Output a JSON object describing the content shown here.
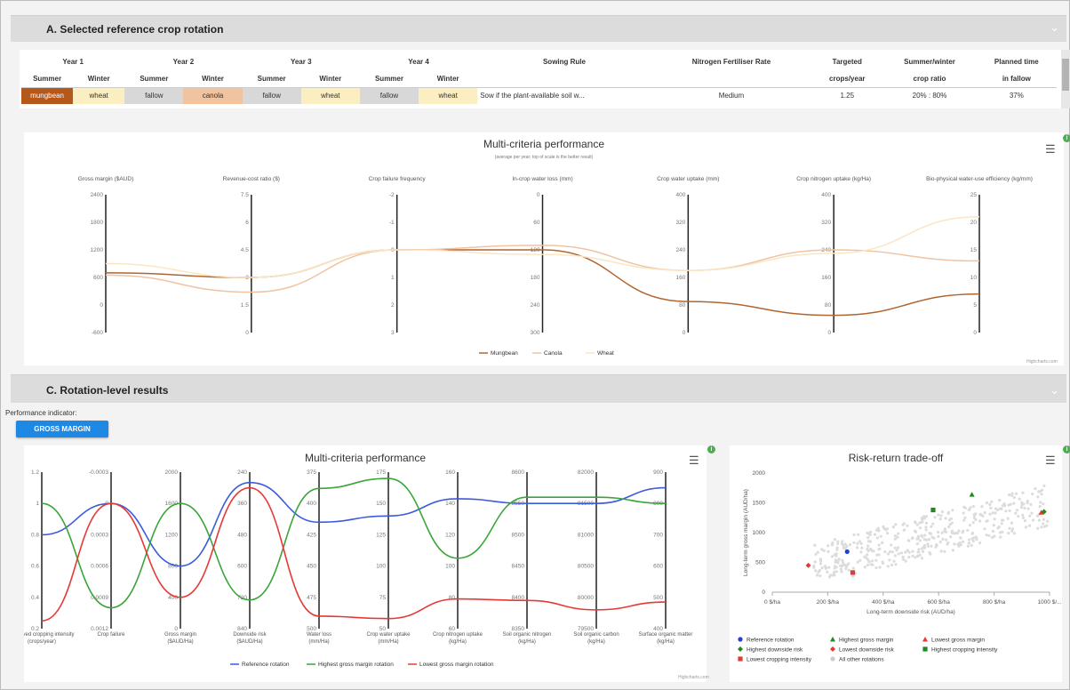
{
  "section_a": {
    "title": "A. Selected reference crop rotation",
    "year_headers": [
      "Year 1",
      "Year 2",
      "Year 3",
      "Year 4"
    ],
    "season_headers": [
      "Summer",
      "Winter",
      "Summer",
      "Winter",
      "Summer",
      "Winter",
      "Summer",
      "Winter"
    ],
    "col_headers_top": {
      "sowing_rule": "Sowing Rule",
      "nitrogen": "Nitrogen Fertiliser Rate",
      "targeted": "Targeted",
      "summer_winter": "Summer/winter",
      "planned": "Planned time"
    },
    "col_headers_bottom": {
      "targeted": "crops/year",
      "summer_winter": "crop ratio",
      "planned": "in fallow"
    },
    "crops": [
      {
        "name": "mungbean",
        "color": "#b5581c",
        "text": "#ffffff"
      },
      {
        "name": "wheat",
        "color": "#fbeec0",
        "text": "#333333"
      },
      {
        "name": "fallow",
        "color": "#d8d8d8",
        "text": "#333333"
      },
      {
        "name": "canola",
        "color": "#f2c39f",
        "text": "#333333"
      },
      {
        "name": "fallow",
        "color": "#d8d8d8",
        "text": "#333333"
      },
      {
        "name": "wheat",
        "color": "#fbeec0",
        "text": "#333333"
      },
      {
        "name": "fallow",
        "color": "#d8d8d8",
        "text": "#333333"
      },
      {
        "name": "wheat",
        "color": "#fbeec0",
        "text": "#333333"
      }
    ],
    "sowing_rule": "Sow if the plant-available soil w...",
    "nitrogen": "Medium",
    "targeted": "1.25",
    "ratio": "20% : 80%",
    "fallow": "37%"
  },
  "section_b": {
    "chart_data": {
      "type": "line",
      "title": "Multi-criteria performance",
      "subtitle": "(average per year; top of scale is the better result)",
      "axes": [
        {
          "label": "Gross margin ($AUD)",
          "ticks": [
            "2400",
            "1800",
            "1200",
            "600",
            "0",
            "-600"
          ]
        },
        {
          "label": "Revenue-cost ratio ($)",
          "ticks": [
            "7.5",
            "6",
            "4.5",
            "3",
            "1.5",
            "0"
          ]
        },
        {
          "label": "Crop failure frequency",
          "ticks": [
            "-2",
            "-1",
            "0",
            "1",
            "2",
            "3"
          ]
        },
        {
          "label": "In-crop water loss (mm)",
          "ticks": [
            "0",
            "60",
            "120",
            "180",
            "240",
            "300"
          ]
        },
        {
          "label": "Crop water uptake (mm)",
          "ticks": [
            "400",
            "320",
            "240",
            "160",
            "80",
            "0"
          ]
        },
        {
          "label": "Crop nitrogen uptake (kg/Ha)",
          "ticks": [
            "400",
            "320",
            "240",
            "160",
            "80",
            "0"
          ]
        },
        {
          "label": "Bio-physical water-use efficiency (kg/mm)",
          "ticks": [
            "25",
            "20",
            "15",
            "10",
            "5",
            "0"
          ]
        }
      ],
      "series": [
        {
          "name": "Mungbean",
          "color": "#b0652e",
          "values": [
            700,
            3,
            0,
            120,
            90,
            50,
            7
          ]
        },
        {
          "name": "Canola",
          "color": "#f0c3a2",
          "values": [
            650,
            2.2,
            0,
            110,
            180,
            240,
            13
          ]
        },
        {
          "name": "Wheat",
          "color": "#fbe6c4",
          "values": [
            900,
            3,
            0,
            130,
            180,
            230,
            21
          ]
        }
      ]
    },
    "credits": "Highcharts.com"
  },
  "section_c": {
    "title": "C. Rotation-level results",
    "indicator_label": "Performance indicator:",
    "button": "GROSS MARGIN",
    "chart_data": [
      {
        "type": "line",
        "title": "Multi-criteria performance",
        "axes": [
          {
            "label": "Achieved cropping intensity (crops/year)",
            "ticks": [
              "1.2",
              "1",
              "0.8",
              "0.6",
              "0.4",
              "0.2"
            ]
          },
          {
            "label": "Crop failure",
            "ticks": [
              "-0.0003",
              "0",
              "0.0003",
              "0.0006",
              "0.0009",
              "0.0012"
            ]
          },
          {
            "label": "Gross margin ($AUD/Ha)",
            "ticks": [
              "2000",
              "1600",
              "1200",
              "800",
              "400",
              "0"
            ]
          },
          {
            "label": "Downside risk ($AUD/Ha)",
            "ticks": [
              "240",
              "360",
              "480",
              "600",
              "720",
              "840"
            ]
          },
          {
            "label": "Water loss (mm/Ha)",
            "ticks": [
              "375",
              "400",
              "425",
              "450",
              "475",
              "500"
            ]
          },
          {
            "label": "Crop water uptake (mm/Ha)",
            "ticks": [
              "175",
              "150",
              "125",
              "100",
              "75",
              "50"
            ]
          },
          {
            "label": "Crop nitrogen uptake (kg/Ha)",
            "ticks": [
              "160",
              "140",
              "120",
              "100",
              "80",
              "60"
            ]
          },
          {
            "label": "Soil organic nitrogen (kg/Ha)",
            "ticks": [
              "8600",
              "8550",
              "8500",
              "8450",
              "8400",
              "8350"
            ]
          },
          {
            "label": "Soil organic carbon (kg/Ha)",
            "ticks": [
              "82000",
              "81500",
              "81000",
              "80500",
              "80000",
              "79500"
            ]
          },
          {
            "label": "Surface organic matter (kg/Ha)",
            "ticks": [
              "900",
              "800",
              "700",
              "600",
              "500",
              "400"
            ]
          }
        ],
        "series": [
          {
            "name": "Reference rotation",
            "color": "#3b5bdb",
            "values": [
              0.8,
              0,
              800,
              280,
              415,
              140,
              143,
              8550,
              81500,
              850
            ]
          },
          {
            "name": "Highest gross margin rotation",
            "color": "#3aa53a",
            "values": [
              1,
              0.001,
              1600,
              730,
              388,
              170,
              105,
              8560,
              81600,
              800
            ]
          },
          {
            "name": "Lowest gross margin rotation",
            "color": "#e53935",
            "values": [
              0.25,
              0,
              400,
              300,
              490,
              58,
              79,
              8395,
              79800,
              485
            ]
          }
        ],
        "credits": "Highcharts.com"
      },
      {
        "type": "scatter",
        "title": "Risk-return trade-off",
        "xlabel": "Long-term downside risk (AUD/ha)",
        "ylabel": "Long-term gross margin (AUD/ha)",
        "xticks": [
          "0 $/ha",
          "200 $/ha",
          "400 $/ha",
          "600 $/ha",
          "800 $/ha",
          "1000 $/..."
        ],
        "yticks": [
          "2000",
          "1500",
          "1000",
          "500",
          "0"
        ],
        "xlim": [
          0,
          1000
        ],
        "ylim": [
          0,
          2000
        ],
        "legend": [
          {
            "label": "Reference rotation",
            "color": "#1f3fd6",
            "shape": "circle"
          },
          {
            "label": "Highest gross margin",
            "color": "#1f8a1f",
            "shape": "triangle"
          },
          {
            "label": "Lowest gross margin",
            "color": "#e53935",
            "shape": "triangle"
          },
          {
            "label": "Highest downside risk",
            "color": "#1f8a1f",
            "shape": "diamond"
          },
          {
            "label": "Lowest downside risk",
            "color": "#e53935",
            "shape": "diamond"
          },
          {
            "label": "Highest cropping intensity",
            "color": "#1f8a1f",
            "shape": "square"
          },
          {
            "label": "Lowest cropping intensity",
            "color": "#e53935",
            "shape": "square"
          },
          {
            "label": "All other rotations",
            "color": "#cccccc",
            "shape": "circle"
          }
        ],
        "points": [
          {
            "series": "Reference rotation",
            "x": 270,
            "y": 680
          },
          {
            "series": "Highest gross margin",
            "x": 720,
            "y": 1640
          },
          {
            "series": "Lowest gross margin",
            "x": 970,
            "y": 1340
          },
          {
            "series": "Highest downside risk",
            "x": 980,
            "y": 1350
          },
          {
            "series": "Lowest downside risk",
            "x": 130,
            "y": 450
          },
          {
            "series": "Highest cropping intensity",
            "x": 580,
            "y": 1380
          },
          {
            "series": "Lowest cropping intensity",
            "x": 290,
            "y": 330
          }
        ]
      }
    ]
  },
  "icons": {
    "menu": "☰",
    "chevron": "⌄",
    "info": "i"
  }
}
